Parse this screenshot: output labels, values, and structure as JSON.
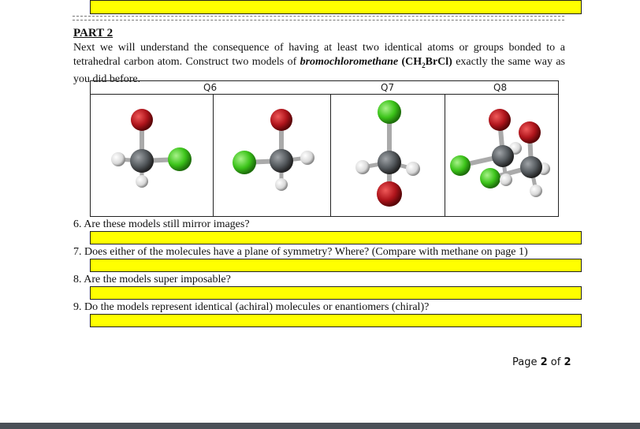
{
  "part": {
    "title": "PART 2"
  },
  "intro": {
    "text_1": "Next we will understand the consequence of having at least two identical atoms or groups bonded to a tetrahedral carbon atom. Construct two models of ",
    "compound_name": "bromochloromethane",
    "formula_open": " (CH",
    "formula_sub": "2",
    "formula_close": "BrCl)",
    "text_2": " exactly the same way as you did before."
  },
  "table": {
    "headers": [
      "Q6",
      "Q7",
      "Q8"
    ]
  },
  "questions": [
    {
      "label": "6. Are these models still mirror images?"
    },
    {
      "label": "7. Does either of the molecules have a plane of symmetry? Where? (Compare with methane on page 1)"
    },
    {
      "label": "8. Are the models super imposable?"
    },
    {
      "label": "9. Do the models represent identical (achiral) molecules or enantiomers (chiral)?"
    }
  ],
  "footer": {
    "page_word": "Page ",
    "page_current": "2",
    "page_of": " of ",
    "page_total": "2"
  },
  "colors": {
    "answer_box": "#ffff00",
    "bromine": "#b0151c",
    "chlorine": "#3cc41a",
    "carbon": "#555a5e",
    "hydrogen": "#e8e8e8"
  }
}
